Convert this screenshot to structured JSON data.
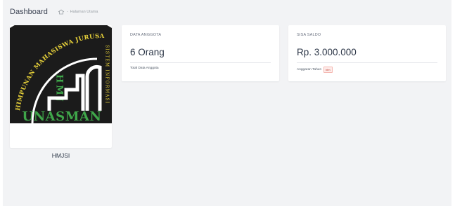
{
  "header": {
    "title": "Dashboard",
    "breadcrumb": {
      "separator": "-",
      "current": "Halaman Utama",
      "home_icon": "home-icon"
    }
  },
  "profile": {
    "logo": {
      "arc_text": "HIMPUNAN MAHASISWA JURUSAN",
      "side_text": "SISTEM INFORMASI",
      "initials": "HMJ",
      "bottom_text": "UNASMAN"
    },
    "name": "HMJSI"
  },
  "stats": {
    "anggota": {
      "label": "DATA ANGGOTA",
      "value": "6 Orang",
      "footer": "Total Data Anggota"
    },
    "saldo": {
      "label": "SISA SALDO",
      "value": "Rp. 3.000.000",
      "footer": "Anggaran Tahun",
      "badge": "blm"
    }
  },
  "colors": {
    "logo_dark": "#1b1b1b",
    "logo_green": "#3fa64a",
    "logo_yellow": "#e8d23a",
    "badge_red": "#c0392b",
    "background": "#f2f3f5"
  }
}
